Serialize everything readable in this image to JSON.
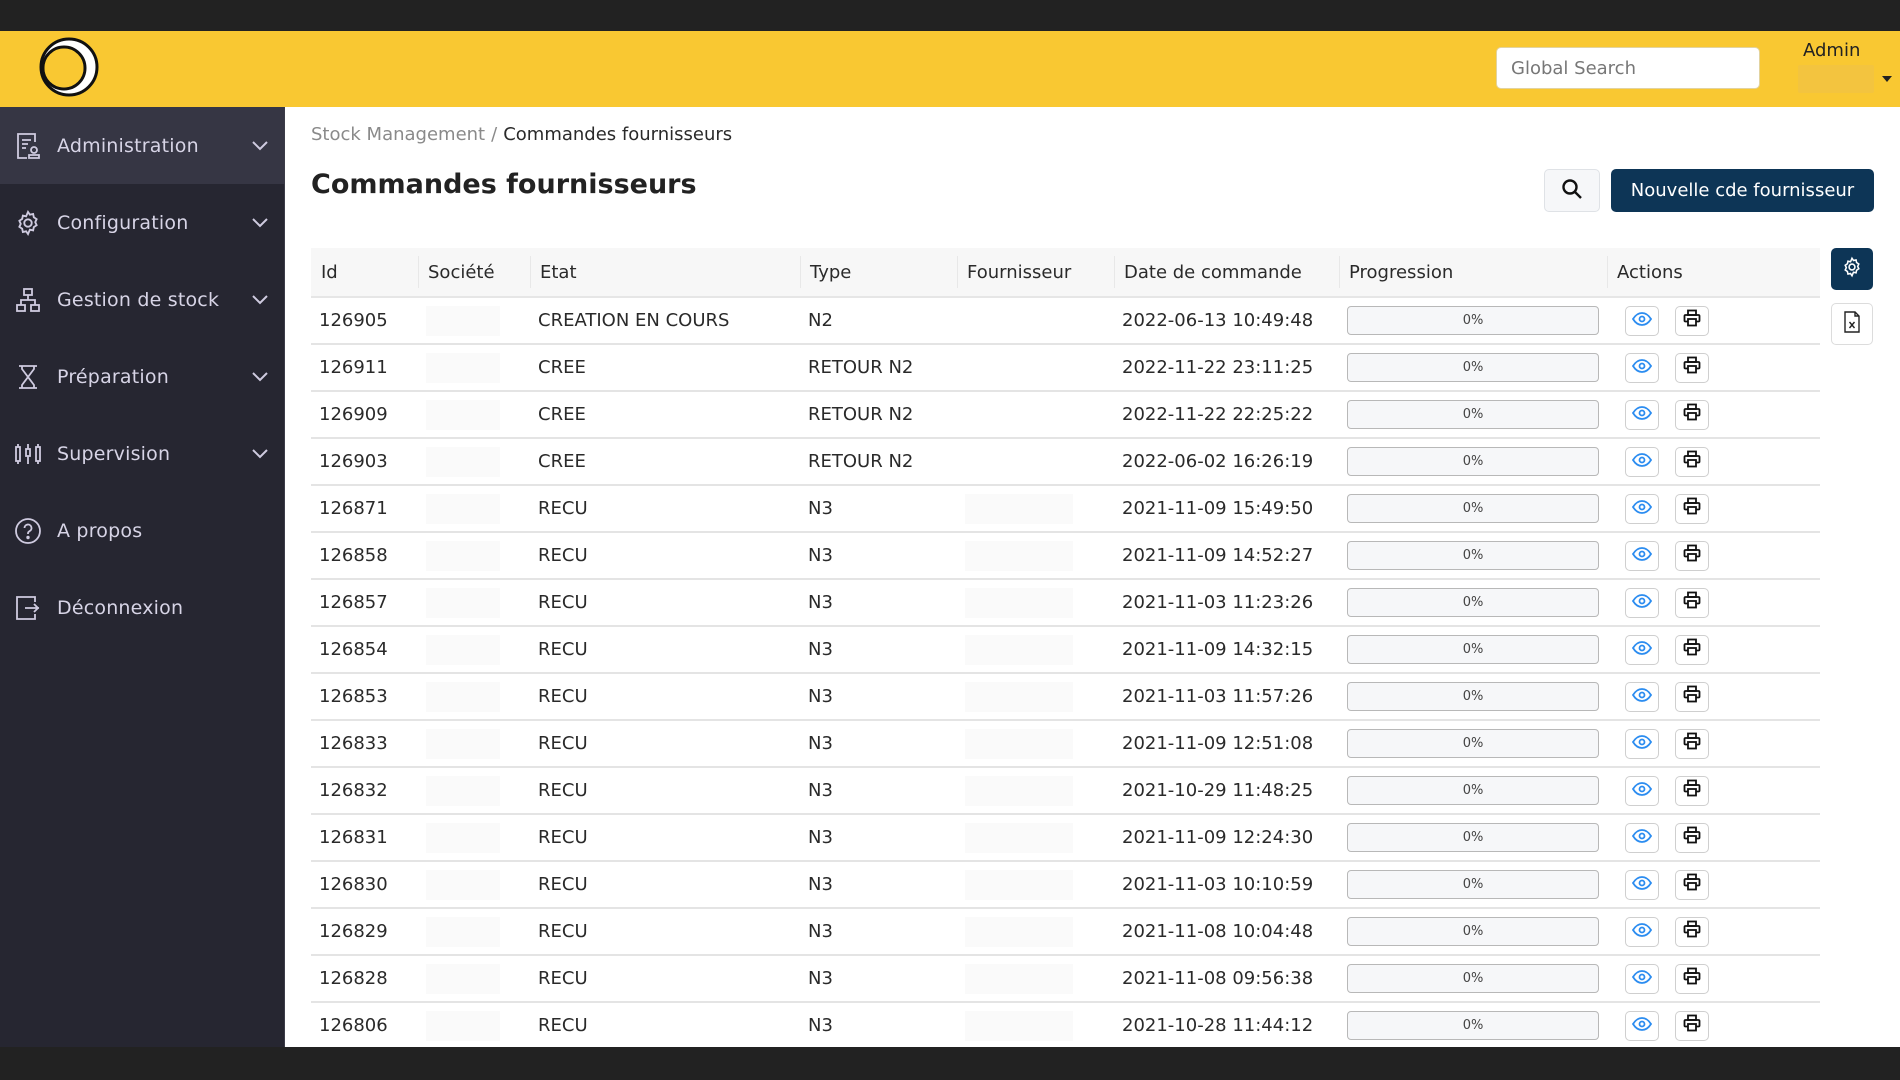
{
  "header": {
    "logo": "logo-icon",
    "search_placeholder": "Global Search",
    "search_value": "",
    "user_label": "Admin"
  },
  "sidebar": {
    "items": [
      {
        "label": "Administration",
        "icon": "admin-badge-icon",
        "expandable": true,
        "active": true
      },
      {
        "label": "Configuration",
        "icon": "gear-icon",
        "expandable": true,
        "active": false
      },
      {
        "label": "Gestion de stock",
        "icon": "hierarchy-icon",
        "expandable": true,
        "active": false
      },
      {
        "label": "Préparation",
        "icon": "hourglass-icon",
        "expandable": true,
        "active": false
      },
      {
        "label": "Supervision",
        "icon": "sliders-icon",
        "expandable": true,
        "active": false
      },
      {
        "label": "A propos",
        "icon": "help-circle-icon",
        "expandable": false,
        "active": false
      },
      {
        "label": "Déconnexion",
        "icon": "logout-icon",
        "expandable": false,
        "active": false
      }
    ]
  },
  "breadcrumb": {
    "parent": "Stock Management",
    "separator": "/",
    "current": "Commandes fournisseurs"
  },
  "page": {
    "title": "Commandes fournisseurs",
    "search_button": "search-icon",
    "new_button_label": "Nouvelle cde fournisseur"
  },
  "table": {
    "columns": [
      "Id",
      "Société",
      "Etat",
      "Type",
      "Fournisseur",
      "Date de commande",
      "Progression",
      "Actions"
    ],
    "rows": [
      {
        "id": "126905",
        "societe": "",
        "etat": "CREATION EN COURS",
        "type": "N2",
        "fournisseur": "",
        "date": "2022-06-13 10:49:48",
        "progress_pct": 0,
        "progress_label": "0%"
      },
      {
        "id": "126911",
        "societe": "",
        "etat": "CREE",
        "type": "RETOUR N2",
        "fournisseur": "",
        "date": "2022-11-22 23:11:25",
        "progress_pct": 0,
        "progress_label": "0%"
      },
      {
        "id": "126909",
        "societe": "",
        "etat": "CREE",
        "type": "RETOUR N2",
        "fournisseur": "",
        "date": "2022-11-22 22:25:22",
        "progress_pct": 0,
        "progress_label": "0%"
      },
      {
        "id": "126903",
        "societe": "",
        "etat": "CREE",
        "type": "RETOUR N2",
        "fournisseur": "",
        "date": "2022-06-02 16:26:19",
        "progress_pct": 0,
        "progress_label": "0%"
      },
      {
        "id": "126871",
        "societe": "",
        "etat": "RECU",
        "type": "N3",
        "fournisseur": "",
        "date": "2021-11-09 15:49:50",
        "progress_pct": 0,
        "progress_label": "0%"
      },
      {
        "id": "126858",
        "societe": "",
        "etat": "RECU",
        "type": "N3",
        "fournisseur": "",
        "date": "2021-11-09 14:52:27",
        "progress_pct": 0,
        "progress_label": "0%"
      },
      {
        "id": "126857",
        "societe": "",
        "etat": "RECU",
        "type": "N3",
        "fournisseur": "",
        "date": "2021-11-03 11:23:26",
        "progress_pct": 0,
        "progress_label": "0%"
      },
      {
        "id": "126854",
        "societe": "",
        "etat": "RECU",
        "type": "N3",
        "fournisseur": "",
        "date": "2021-11-09 14:32:15",
        "progress_pct": 0,
        "progress_label": "0%"
      },
      {
        "id": "126853",
        "societe": "",
        "etat": "RECU",
        "type": "N3",
        "fournisseur": "",
        "date": "2021-11-03 11:57:26",
        "progress_pct": 0,
        "progress_label": "0%"
      },
      {
        "id": "126833",
        "societe": "",
        "etat": "RECU",
        "type": "N3",
        "fournisseur": "",
        "date": "2021-11-09 12:51:08",
        "progress_pct": 0,
        "progress_label": "0%"
      },
      {
        "id": "126832",
        "societe": "",
        "etat": "RECU",
        "type": "N3",
        "fournisseur": "",
        "date": "2021-10-29 11:48:25",
        "progress_pct": 0,
        "progress_label": "0%"
      },
      {
        "id": "126831",
        "societe": "",
        "etat": "RECU",
        "type": "N3",
        "fournisseur": "",
        "date": "2021-11-09 12:24:30",
        "progress_pct": 0,
        "progress_label": "0%"
      },
      {
        "id": "126830",
        "societe": "",
        "etat": "RECU",
        "type": "N3",
        "fournisseur": "",
        "date": "2021-11-03 10:10:59",
        "progress_pct": 0,
        "progress_label": "0%"
      },
      {
        "id": "126829",
        "societe": "",
        "etat": "RECU",
        "type": "N3",
        "fournisseur": "",
        "date": "2021-11-08 10:04:48",
        "progress_pct": 0,
        "progress_label": "0%"
      },
      {
        "id": "126828",
        "societe": "",
        "etat": "RECU",
        "type": "N3",
        "fournisseur": "",
        "date": "2021-11-08 09:56:38",
        "progress_pct": 0,
        "progress_label": "0%"
      },
      {
        "id": "126806",
        "societe": "",
        "etat": "RECU",
        "type": "N3",
        "fournisseur": "",
        "date": "2021-10-28 11:44:12",
        "progress_pct": 0,
        "progress_label": "0%"
      }
    ],
    "row_actions": [
      "view-icon",
      "print-icon"
    ],
    "side_tools": [
      "column-settings-icon",
      "excel-export-icon"
    ]
  },
  "colors": {
    "header_bg": "#f9c832",
    "sidebar_bg": "#262631",
    "sidebar_active_bg": "#363644",
    "primary": "#0d3556",
    "view_icon": "#2b8cf0",
    "chrome": "#222222"
  }
}
